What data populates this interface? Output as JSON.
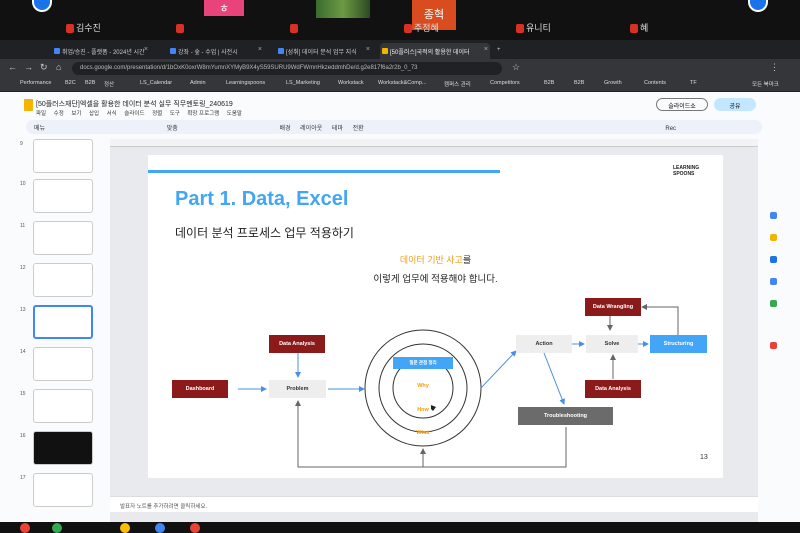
{
  "video": {
    "participants": [
      "김수진",
      "",
      "",
      "주정혜",
      "유니티",
      "혜"
    ],
    "avatar_letters": [
      "ㅎ",
      "종혁"
    ]
  },
  "browser": {
    "tabs": [
      {
        "label": "취업/승진 - 플랫폼 - 2024년 시간"
      },
      {
        "label": "강좌 - 숲 - 수업 | 사전시"
      },
      {
        "label": "[성취] 데이터 분석 업무 지식"
      },
      {
        "label": "[50플러스]국적의 활용한 데이터"
      }
    ],
    "url": "docs.google.com/presentation/d/1bOxK0oxrW8mYumnXYMyB9X4yS59SURU9WdFWmnHkzeddmhDe/d.g2e817f6a2r2b_0_73",
    "bookmarks": [
      "Performance",
      "B2C",
      "B2B",
      "정산",
      "LS_Calendar",
      "Admin",
      "Learningspoons",
      "LS_Marketing",
      "Workstack",
      "Workstack&Comp...",
      "캠퍼스 관리",
      "Competitors",
      "B2B",
      "B2B",
      "Growth",
      "Contents",
      "TF",
      "모든 북마크"
    ]
  },
  "docs": {
    "title": "[50플러스재단]엑셀을 활용한 데이터 분석 실무 직무멘토링_240619",
    "menu": [
      "파일",
      "수정",
      "보기",
      "삽입",
      "서식",
      "슬라이드",
      "정렬",
      "도구",
      "확장 프로그램",
      "도움말"
    ],
    "toolbar": [
      "메뉴",
      "맞춤",
      "배경",
      "레이아웃",
      "테마",
      "전환",
      "Rec"
    ],
    "slideshow_label": "슬라이드쇼",
    "share_label": "공유",
    "notes_placeholder": "발표자 노트를 추가하려면 클릭하세요.",
    "thumb_numbers": [
      "9",
      "10",
      "11",
      "12",
      "13",
      "14",
      "15",
      "16",
      "17"
    ]
  },
  "slide": {
    "title": "Part 1. Data, Excel",
    "subtitle": "데이터 분석 프로세스 업무 적용하기",
    "highlight": "데이터 기반 사고",
    "highlight_suffix": "를",
    "line2": "이렇게 업무에 적용해야 합니다.",
    "logo_line1": "LEARNING",
    "logo_line2": "SPOONS",
    "page": "13",
    "nodes": {
      "dashboard": "Dashboard",
      "data_analysis_1": "Data Analysis",
      "problem": "Problem",
      "question": "질문 관점 정리",
      "why": "Why",
      "how": "How",
      "what": "What",
      "action": "Action",
      "solve": "Solve",
      "structuring": "Structuring",
      "data_wrangling": "Data Wrangling",
      "data_analysis_2": "Data Analysis",
      "troubleshooting": "Troubleshooting"
    }
  },
  "colors": {
    "accent_blue": "#42a5f5",
    "dark_red": "#8b1a1a",
    "orange": "#f39c12"
  }
}
